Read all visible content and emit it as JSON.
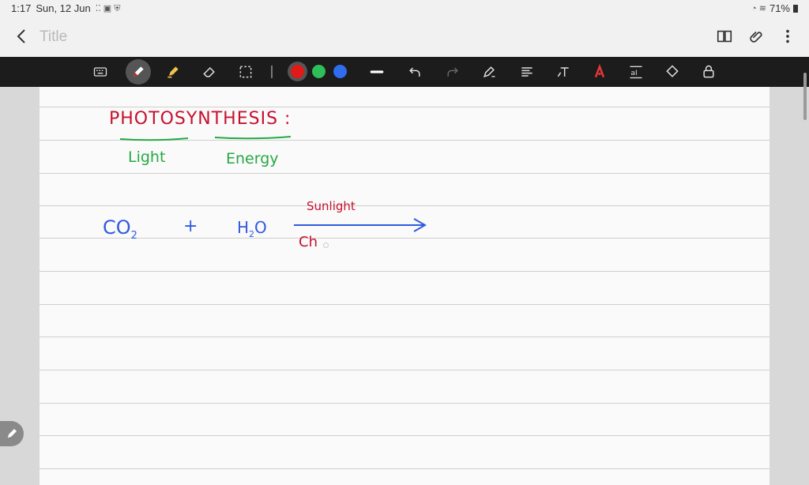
{
  "status_bar": {
    "time": "1:17",
    "date": "Sun, 12 Jun",
    "battery": "71%"
  },
  "app_bar": {
    "title_placeholder": "Title",
    "icons": [
      "back-arrow-icon",
      "book-view-icon",
      "attach-clip-icon",
      "more-menu-icon"
    ]
  },
  "toolbar": {
    "tools": [
      "keyboard-icon",
      "pen-icon",
      "highlighter-icon",
      "eraser-icon",
      "lasso-select-icon",
      "stroke-width-icon",
      "undo-icon",
      "redo-icon",
      "shape-pen-icon",
      "text-align-icon",
      "text-tool-icon",
      "brand-icon",
      "text-format-icon",
      "shapes-icon",
      "lock-icon"
    ],
    "colors": {
      "red": "#e11919",
      "green": "#2fbf58",
      "blue": "#2f6cf0"
    },
    "selected_tool": "pen",
    "selected_color": "red"
  },
  "note": {
    "heading": "PHOTOSYNTHESIS :",
    "word_light": "Light",
    "word_energy": "Energy",
    "reactant_1": "CO",
    "reactant_1_sub": "2",
    "plus": "+",
    "reactant_2_main": "H",
    "reactant_2_sub": "2",
    "reactant_2_end": "O",
    "above_arrow": "Sunlight",
    "below_arrow": "Ch",
    "ink_colors": {
      "heading": "#c8102e",
      "keywords": "#27a844",
      "equation": "#2f5be0"
    }
  }
}
